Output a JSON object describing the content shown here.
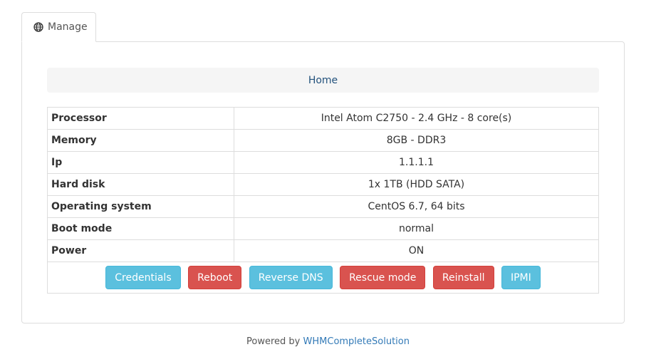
{
  "tab": {
    "label": "Manage",
    "icon": "globe-icon"
  },
  "breadcrumb": {
    "home": "Home"
  },
  "specs": [
    {
      "key": "Processor",
      "value": "Intel Atom C2750 - 2.4 GHz - 8 core(s)"
    },
    {
      "key": "Memory",
      "value": "8GB - DDR3"
    },
    {
      "key": "Ip",
      "value": "1.1.1.1"
    },
    {
      "key": "Hard disk",
      "value": "1x 1TB (HDD SATA)"
    },
    {
      "key": "Operating system",
      "value": "CentOS 6.7, 64 bits"
    },
    {
      "key": "Boot mode",
      "value": "normal"
    },
    {
      "key": "Power",
      "value": "ON"
    }
  ],
  "actions": {
    "credentials": "Credentials",
    "reboot": "Reboot",
    "reverse_dns": "Reverse DNS",
    "rescue_mode": "Rescue mode",
    "reinstall": "Reinstall",
    "ipmi": "IPMI"
  },
  "colors": {
    "info": "#5bc0de",
    "danger": "#d9534f",
    "link": "#23527c"
  },
  "footer": {
    "prefix": "Powered by",
    "link": "WHMCompleteSolution"
  }
}
